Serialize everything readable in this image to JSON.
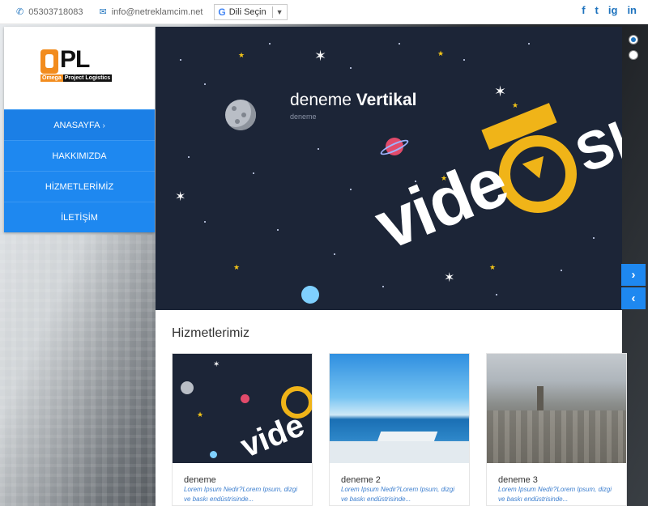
{
  "topbar": {
    "phone": "05303718083",
    "email": "info@netreklamcim.net",
    "language_select": "Dili Seçin",
    "social": [
      "f",
      "t",
      "ig",
      "in"
    ]
  },
  "logo": {
    "letters": "PL",
    "sub_left": "Omega",
    "sub_right": "Project Logistics"
  },
  "menu": {
    "items": [
      {
        "label": "ANASAYFA",
        "icon": "chevron-right-icon"
      },
      {
        "label": "HAKKIMIZDA"
      },
      {
        "label": "HİZMETLERİMİZ"
      },
      {
        "label": "İLETİŞİM"
      }
    ]
  },
  "hero": {
    "title_light": "deneme",
    "title_bold": "Vertikal",
    "subtitle": "deneme",
    "graphic_word": "vide",
    "graphic_word_2": "SI"
  },
  "services": {
    "title": "Hizmetlerimiz",
    "cards": [
      {
        "title": "deneme",
        "text": "Lorem Ipsum Nedir?Lorem Ipsum, dizgi ve baskı endüstrisinde...",
        "graphic_word": "vide"
      },
      {
        "title": "deneme 2",
        "text": "Lorem Ipsum Nedir?Lorem Ipsum, dizgi ve baskı endüstrisinde..."
      },
      {
        "title": "deneme 3",
        "text": "Lorem Ipsum Nedir?Lorem Ipsum, dizgi ve baskı endüstrisinde..."
      }
    ]
  },
  "colors": {
    "accent": "#1e88f0",
    "brand_orange": "#f28c1e",
    "hero_bg": "#1c2537",
    "gold": "#f0b418"
  }
}
